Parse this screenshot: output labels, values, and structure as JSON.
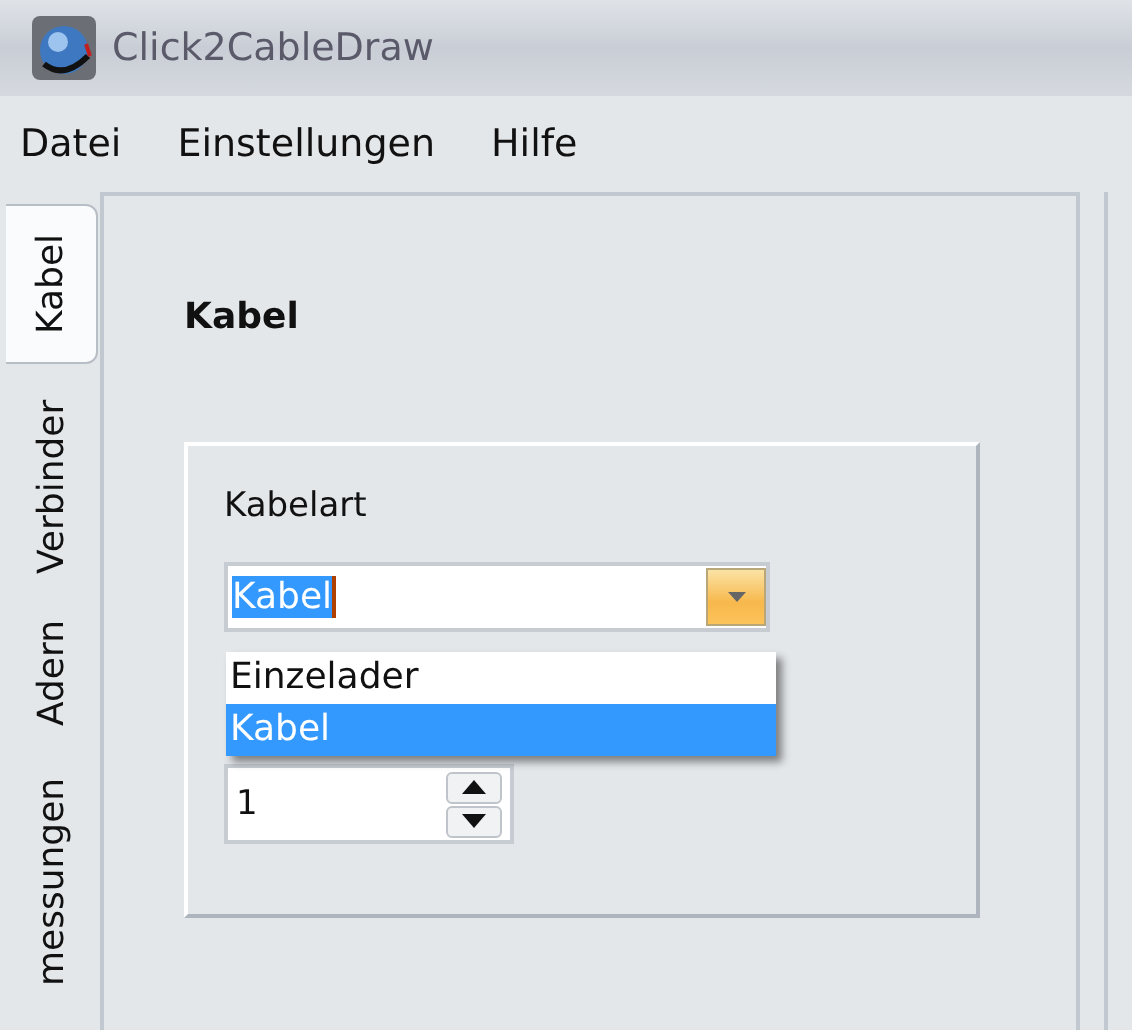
{
  "window": {
    "title": "Click2CableDraw"
  },
  "menu": [
    "Datei",
    "Einstellungen",
    "Hilfe"
  ],
  "tabs": [
    {
      "label": "Kabel",
      "selected": true
    },
    {
      "label": "Verbinder",
      "selected": false
    },
    {
      "label": "Adern",
      "selected": false
    },
    {
      "label": "messungen",
      "selected": false
    }
  ],
  "panel": {
    "heading": "Kabel",
    "group": {
      "label": "Kabelart",
      "combo": {
        "value": "Kabel",
        "expanded": true,
        "options": [
          {
            "label": "Einzelader",
            "selected": false
          },
          {
            "label": "Kabel",
            "selected": true
          }
        ]
      },
      "spin": {
        "value": "1"
      }
    }
  }
}
